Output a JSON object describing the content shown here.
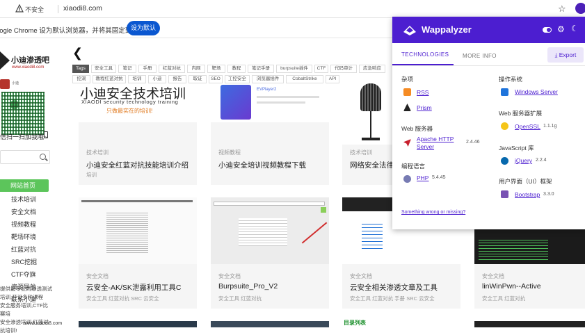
{
  "browser": {
    "insecure_label": "不安全",
    "url": "xiaodi8.com",
    "infobar_text": "oogle Chrome 设为默认浏览器，并将其固定到任务栏",
    "set_default_label": "设为默认"
  },
  "sidebar": {
    "logo_text": "小迪渗透吧",
    "logo_url": "www.xiaodi8.com",
    "avatar_text": "小迪",
    "qr_caption": "信扫一扫加我哦~",
    "nav": [
      {
        "label": "网站首页"
      },
      {
        "label": "技术培训"
      },
      {
        "label": "安全文档"
      },
      {
        "label": "视频教程"
      },
      {
        "label": "靶场环境"
      },
      {
        "label": "红蓝对抗"
      },
      {
        "label": "SRC挖掘"
      },
      {
        "label": "CTF夺旗"
      },
      {
        "label": "资源导航"
      },
      {
        "label": "联系小迪"
      }
    ],
    "overlay_lines": [
      "提供最专业的渗透测试",
      "培训,开设多种课程",
      "安全服务培训,CTF比赛培",
      "安全渗透培训,红蓝对抗培训!"
    ],
    "footer_url": "www.xiaodi8.com"
  },
  "main": {
    "tags_row1": [
      "Tags",
      "安全工具",
      "笔记",
      "手册",
      "红蓝对抗",
      "内网",
      "靶场",
      "教程",
      "笔记手册",
      "burpsuite插件",
      "CTF",
      "代码审计",
      "应急响应"
    ],
    "tags_row2": [
      "挖洞",
      "教程红蓝对抗",
      "培训",
      "小迪",
      "报告",
      "取证",
      "SEO",
      "工控安全",
      "浏览器插件",
      "CobaltStrike",
      "API"
    ],
    "cards_row1": [
      {
        "category": "技术培训",
        "title": "小迪安全红蓝对抗技能培训介绍",
        "tags": "培训",
        "thumb_text": "小迪安全技术培训",
        "thumb_sub": "XIAODI security technology training",
        "thumb_slogan": "只做最实在的培训!"
      },
      {
        "category": "视频教程",
        "title": "小迪安全培训视频教程下载",
        "tags": "",
        "thumb_text": "EVPlayer2"
      },
      {
        "category": "技术培训",
        "title": "网络安全法律法",
        "tags": "",
        "thumb_text": ""
      }
    ],
    "cards_row2": [
      {
        "category": "安全文档",
        "title": "云安全-AK/SK泄露利用工具C",
        "tags": "安全工具 红蓝对抗 SRC 云安全"
      },
      {
        "category": "安全文档",
        "title": "Burpsuite_Pro_V2",
        "tags": "安全工具 红蓝对抗"
      },
      {
        "category": "安全文档",
        "title": "云安全相关渗透文章及工具",
        "tags": "安全工具 红蓝对抗 手册 SRC 云安全"
      },
      {
        "category": "安全文档",
        "title": "linWinPwn--Active",
        "tags": "安全工具 红蓝对抗"
      }
    ],
    "bottom_label": "目录列表"
  },
  "wappalyzer": {
    "brand": "Wappalyzer",
    "tab_technologies": "TECHNOLOGIES",
    "tab_more": "MORE INFO",
    "export_label": "Export",
    "left": [
      {
        "category": "杂项",
        "items": [
          {
            "name": "RSS",
            "version": "",
            "icon": "rss-icon"
          },
          {
            "name": "Prism",
            "version": "",
            "icon": "prism-icon"
          }
        ]
      },
      {
        "category": "Web 服务器",
        "items": [
          {
            "name": "Apache HTTP Server",
            "version": "2.4.46",
            "icon": "apache-icon"
          }
        ]
      },
      {
        "category": "编程语言",
        "items": [
          {
            "name": "PHP",
            "version": "5.4.45",
            "icon": "php-icon"
          }
        ]
      }
    ],
    "right": [
      {
        "category": "操作系统",
        "items": [
          {
            "name": "Windows Server",
            "version": "",
            "icon": "windows-icon"
          }
        ]
      },
      {
        "category": "Web 服务器扩展",
        "items": [
          {
            "name": "OpenSSL",
            "version": "1.1.1g",
            "icon": "openssl-icon"
          }
        ]
      },
      {
        "category": "JavaScript 库",
        "items": [
          {
            "name": "jQuery",
            "version": "2.2.4",
            "icon": "jquery-icon"
          }
        ]
      },
      {
        "category": "用户界面（UI）框架",
        "items": [
          {
            "name": "Bootstrap",
            "version": "3.3.0",
            "icon": "bootstrap-icon"
          }
        ]
      }
    ],
    "wrong_link": "Something wrong or missing?",
    "colors": {
      "brand": "#4c1ed0"
    }
  }
}
